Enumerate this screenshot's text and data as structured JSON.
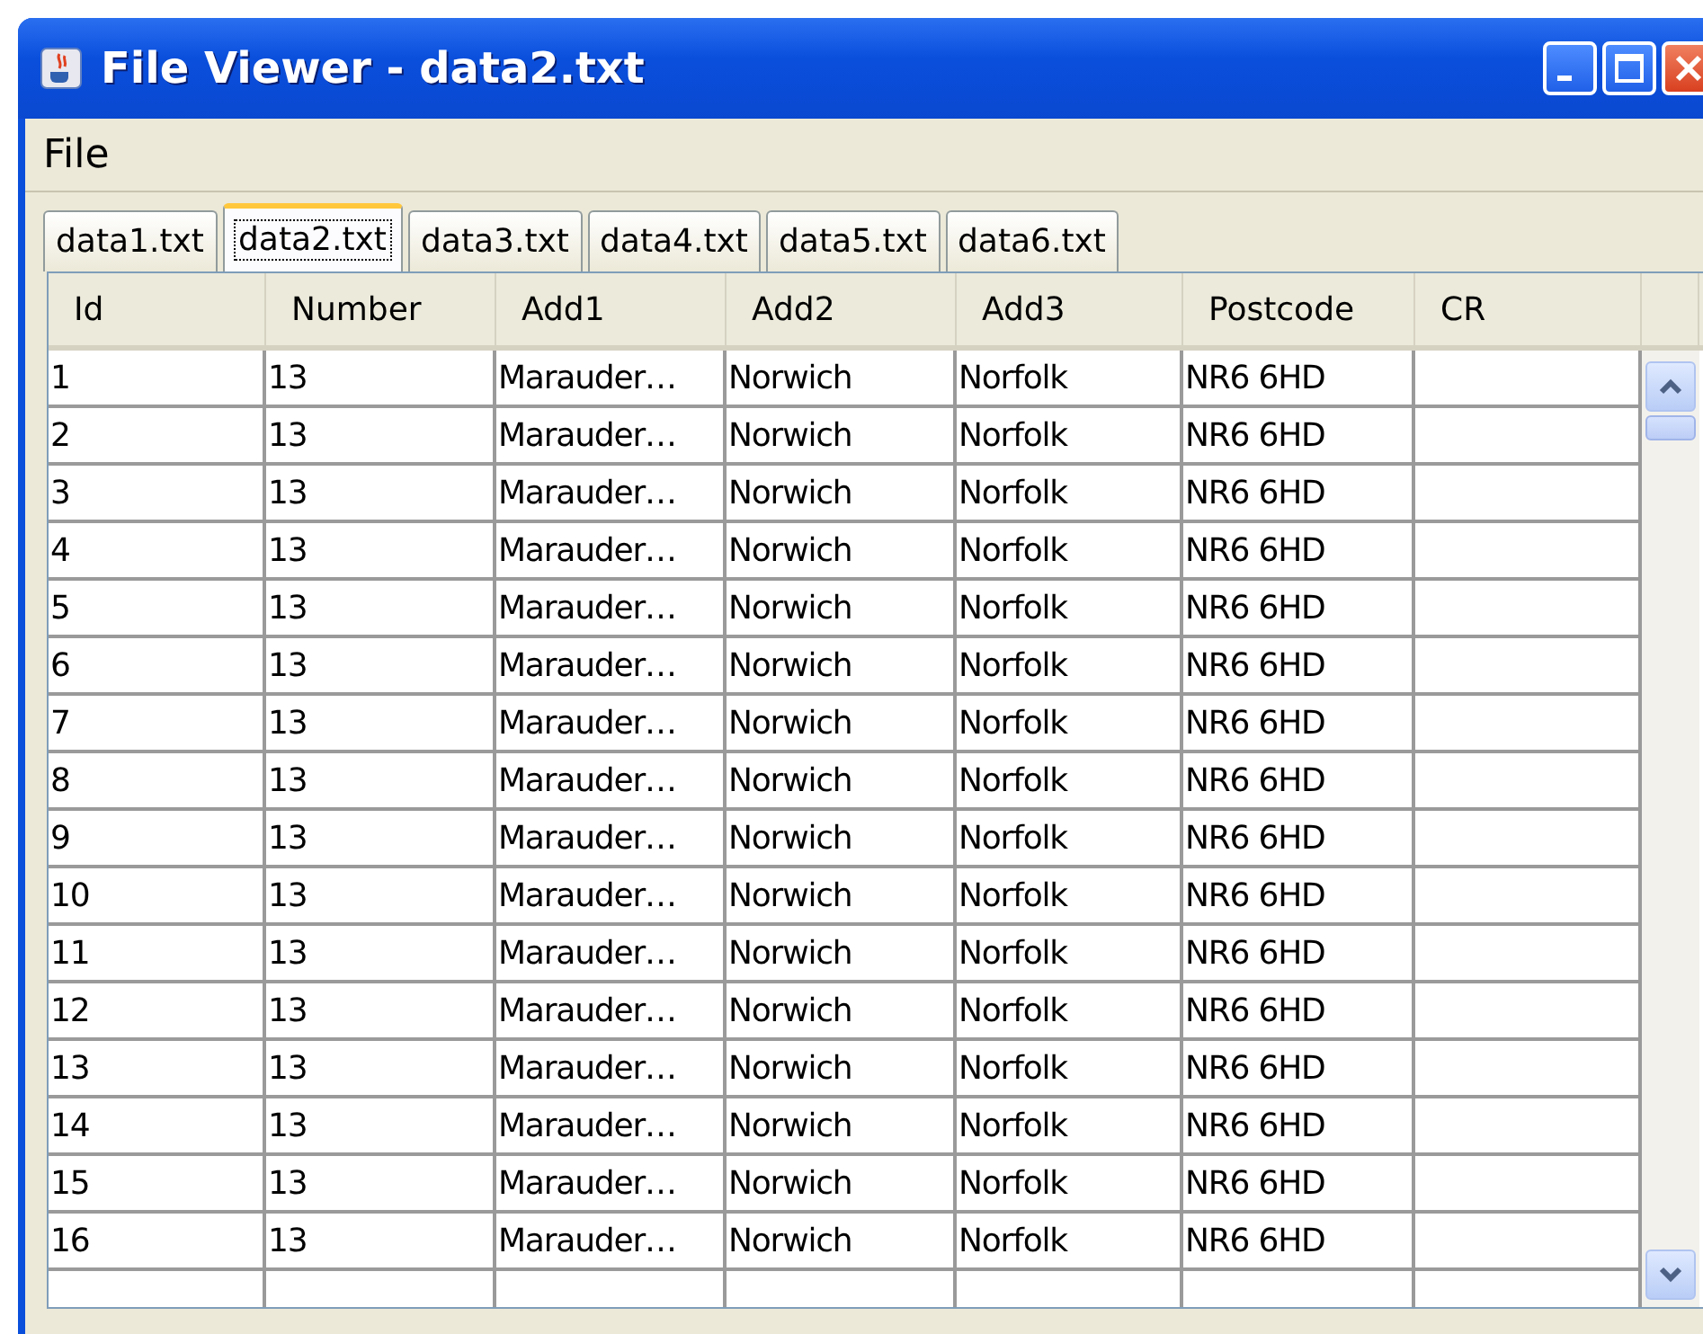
{
  "window": {
    "title": "File Viewer - data2.txt"
  },
  "menu": [
    "File"
  ],
  "tabs": [
    {
      "label": "data1.txt",
      "selected": false
    },
    {
      "label": "data2.txt",
      "selected": true
    },
    {
      "label": "data3.txt",
      "selected": false
    },
    {
      "label": "data4.txt",
      "selected": false
    },
    {
      "label": "data5.txt",
      "selected": false
    },
    {
      "label": "data6.txt",
      "selected": false
    }
  ],
  "table": {
    "columns": [
      "Id",
      "Number",
      "Add1",
      "Add2",
      "Add3",
      "Postcode",
      "CR"
    ],
    "rows": [
      [
        "1",
        "13",
        "Marauder…",
        "Norwich",
        "Norfolk",
        "NR6 6HD"
      ],
      [
        "2",
        "13",
        "Marauder…",
        "Norwich",
        "Norfolk",
        "NR6 6HD"
      ],
      [
        "3",
        "13",
        "Marauder…",
        "Norwich",
        "Norfolk",
        "NR6 6HD"
      ],
      [
        "4",
        "13",
        "Marauder…",
        "Norwich",
        "Norfolk",
        "NR6 6HD"
      ],
      [
        "5",
        "13",
        "Marauder…",
        "Norwich",
        "Norfolk",
        "NR6 6HD"
      ],
      [
        "6",
        "13",
        "Marauder…",
        "Norwich",
        "Norfolk",
        "NR6 6HD"
      ],
      [
        "7",
        "13",
        "Marauder…",
        "Norwich",
        "Norfolk",
        "NR6 6HD"
      ],
      [
        "8",
        "13",
        "Marauder…",
        "Norwich",
        "Norfolk",
        "NR6 6HD"
      ],
      [
        "9",
        "13",
        "Marauder…",
        "Norwich",
        "Norfolk",
        "NR6 6HD"
      ],
      [
        "10",
        "13",
        "Marauder…",
        "Norwich",
        "Norfolk",
        "NR6 6HD"
      ],
      [
        "11",
        "13",
        "Marauder…",
        "Norwich",
        "Norfolk",
        "NR6 6HD"
      ],
      [
        "12",
        "13",
        "Marauder…",
        "Norwich",
        "Norfolk",
        "NR6 6HD"
      ],
      [
        "13",
        "13",
        "Marauder…",
        "Norwich",
        "Norfolk",
        "NR6 6HD"
      ],
      [
        "14",
        "13",
        "Marauder…",
        "Norwich",
        "Norfolk",
        "NR6 6HD"
      ],
      [
        "15",
        "13",
        "Marauder…",
        "Norwich",
        "Norfolk",
        "NR6 6HD"
      ],
      [
        "16",
        "13",
        "Marauder…",
        "Norwich",
        "Norfolk",
        "NR6 6HD"
      ]
    ]
  }
}
